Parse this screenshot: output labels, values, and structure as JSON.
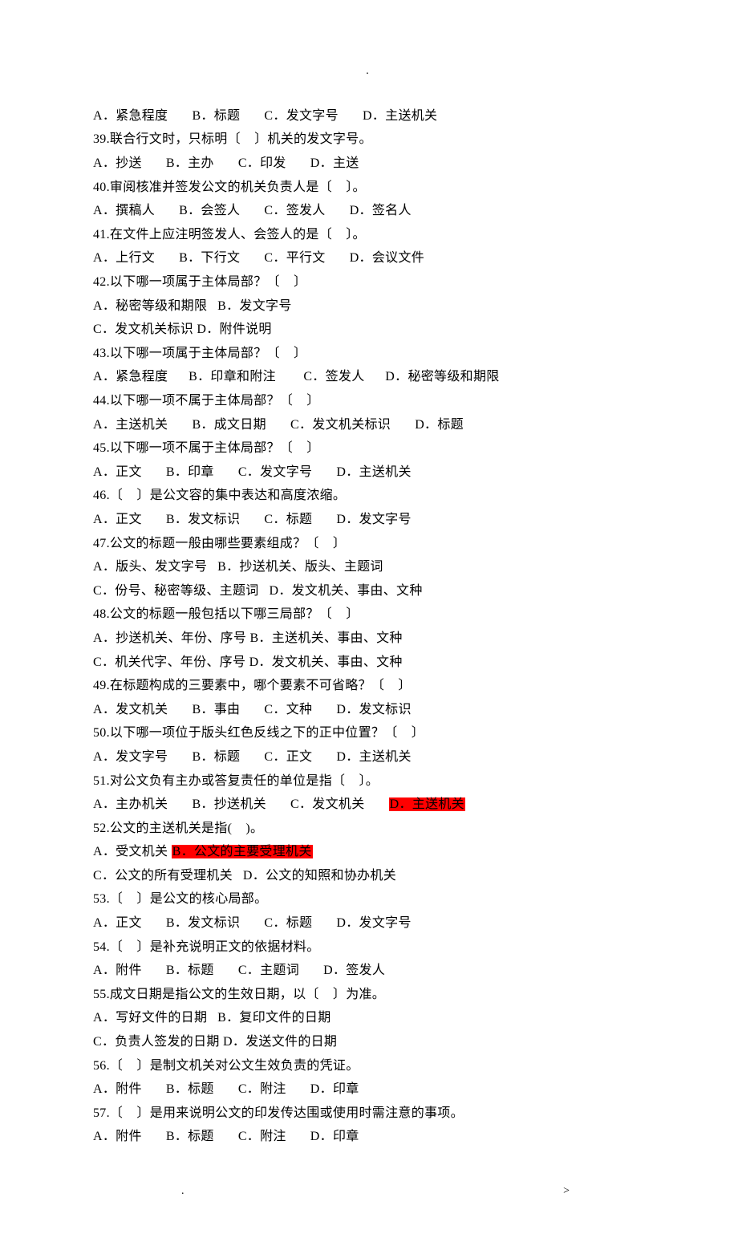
{
  "top_dot": ".",
  "lines": [
    {
      "segs": [
        {
          "t": "A．紧急程度       B．标题       C．发文字号       D．主送机关"
        }
      ]
    },
    {
      "segs": [
        {
          "t": "39.联合行文时，只标明〔    〕机关的发文字号。"
        }
      ]
    },
    {
      "segs": [
        {
          "t": "A．抄送       B．主办       C．印发       D．主送"
        }
      ]
    },
    {
      "segs": [
        {
          "t": "40.审阅核准并签发公文的机关负责人是〔    〕。"
        }
      ]
    },
    {
      "segs": [
        {
          "t": "A．撰稿人       B．会签人       C．签发人       D．签名人"
        }
      ]
    },
    {
      "segs": [
        {
          "t": "41.在文件上应注明签发人、会签人的是〔    〕。"
        }
      ]
    },
    {
      "segs": [
        {
          "t": "A．上行文       B．下行文       C．平行文       D．会议文件"
        }
      ]
    },
    {
      "segs": [
        {
          "t": "42.以下哪一项属于主体局部？〔    〕"
        }
      ]
    },
    {
      "segs": [
        {
          "t": "A．秘密等级和期限   B．发文字号"
        }
      ]
    },
    {
      "segs": [
        {
          "t": "C．发文机关标识 D．附件说明"
        }
      ]
    },
    {
      "segs": [
        {
          "t": "43.以下哪一项属于主体局部？〔    〕"
        }
      ]
    },
    {
      "segs": [
        {
          "t": "A．紧急程度      B．印章和附注        C．签发人      D．秘密等级和期限"
        }
      ]
    },
    {
      "segs": [
        {
          "t": "44.以下哪一项不属于主体局部？〔    〕"
        }
      ]
    },
    {
      "segs": [
        {
          "t": "A．主送机关       B．成文日期       C．发文机关标识       D．标题"
        }
      ]
    },
    {
      "segs": [
        {
          "t": "45.以下哪一项不属于主体局部？〔    〕"
        }
      ]
    },
    {
      "segs": [
        {
          "t": "A．正文       B．印章       C．发文字号       D．主送机关"
        }
      ]
    },
    {
      "segs": [
        {
          "t": "46.〔    〕是公文容的集中表达和高度浓缩。"
        }
      ]
    },
    {
      "segs": [
        {
          "t": "A．正文       B．发文标识       C．标题       D．发文字号"
        }
      ]
    },
    {
      "segs": [
        {
          "t": "47.公文的标题一般由哪些要素组成？〔    〕"
        }
      ]
    },
    {
      "segs": [
        {
          "t": "A．版头、发文字号   B．抄送机关、版头、主题词"
        }
      ]
    },
    {
      "segs": [
        {
          "t": "C．份号、秘密等级、主题词   D．发文机关、事由、文种"
        }
      ]
    },
    {
      "segs": [
        {
          "t": "48.公文的标题一般包括以下哪三局部？〔    〕"
        }
      ]
    },
    {
      "segs": [
        {
          "t": "A．抄送机关、年份、序号 B．主送机关、事由、文种"
        }
      ]
    },
    {
      "segs": [
        {
          "t": "C．机关代字、年份、序号 D．发文机关、事由、文种"
        }
      ]
    },
    {
      "segs": [
        {
          "t": "49.在标题构成的三要素中，哪个要素不可省略？〔    〕"
        }
      ]
    },
    {
      "segs": [
        {
          "t": "A．发文机关       B．事由       C．文种       D．发文标识"
        }
      ]
    },
    {
      "segs": [
        {
          "t": "50.以下哪一项位于版头红色反线之下的正中位置？〔    〕"
        }
      ]
    },
    {
      "segs": [
        {
          "t": "A．发文字号       B．标题       C．正文       D．主送机关"
        }
      ]
    },
    {
      "segs": [
        {
          "t": "51.对公文负有主办或答复责任的单位是指〔    〕。"
        }
      ]
    },
    {
      "segs": [
        {
          "t": "A．主办机关       B．抄送机关       C．发文机关       "
        },
        {
          "t": "D．主送机关",
          "hl": true
        }
      ]
    },
    {
      "segs": [
        {
          "t": "52.公文的主送机关是指(    )。"
        }
      ]
    },
    {
      "segs": [
        {
          "t": "A．受文机关 "
        },
        {
          "t": "B．公文的主要受理机关",
          "hl": true
        }
      ]
    },
    {
      "segs": [
        {
          "t": "C．公文的所有受理机关   D．公文的知照和协办机关"
        }
      ]
    },
    {
      "segs": [
        {
          "t": "53.〔    〕是公文的核心局部。"
        }
      ]
    },
    {
      "segs": [
        {
          "t": "A．正文       B．发文标识       C．标题       D．发文字号"
        }
      ]
    },
    {
      "segs": [
        {
          "t": "54.〔    〕是补充说明正文的依据材料。"
        }
      ]
    },
    {
      "segs": [
        {
          "t": "A．附件       B．标题       C．主题词       D．签发人"
        }
      ]
    },
    {
      "segs": [
        {
          "t": "55.成文日期是指公文的生效日期，以〔    〕为准。"
        }
      ]
    },
    {
      "segs": [
        {
          "t": "A．写好文件的日期   B．复印文件的日期"
        }
      ]
    },
    {
      "segs": [
        {
          "t": "C．负责人签发的日期 D．发送文件的日期"
        }
      ]
    },
    {
      "segs": [
        {
          "t": "56.〔    〕是制文机关对公文生效负责的凭证。"
        }
      ]
    },
    {
      "segs": [
        {
          "t": "A．附件       B．标题       C．附注       D．印章"
        }
      ]
    },
    {
      "segs": [
        {
          "t": "57.〔    〕是用来说明公文的印发传达围或使用时需注意的事项。"
        }
      ]
    },
    {
      "segs": [
        {
          "t": "A．附件       B．标题       C．附注       D．印章"
        }
      ]
    }
  ],
  "footer_left": ".",
  "footer_right": ">"
}
